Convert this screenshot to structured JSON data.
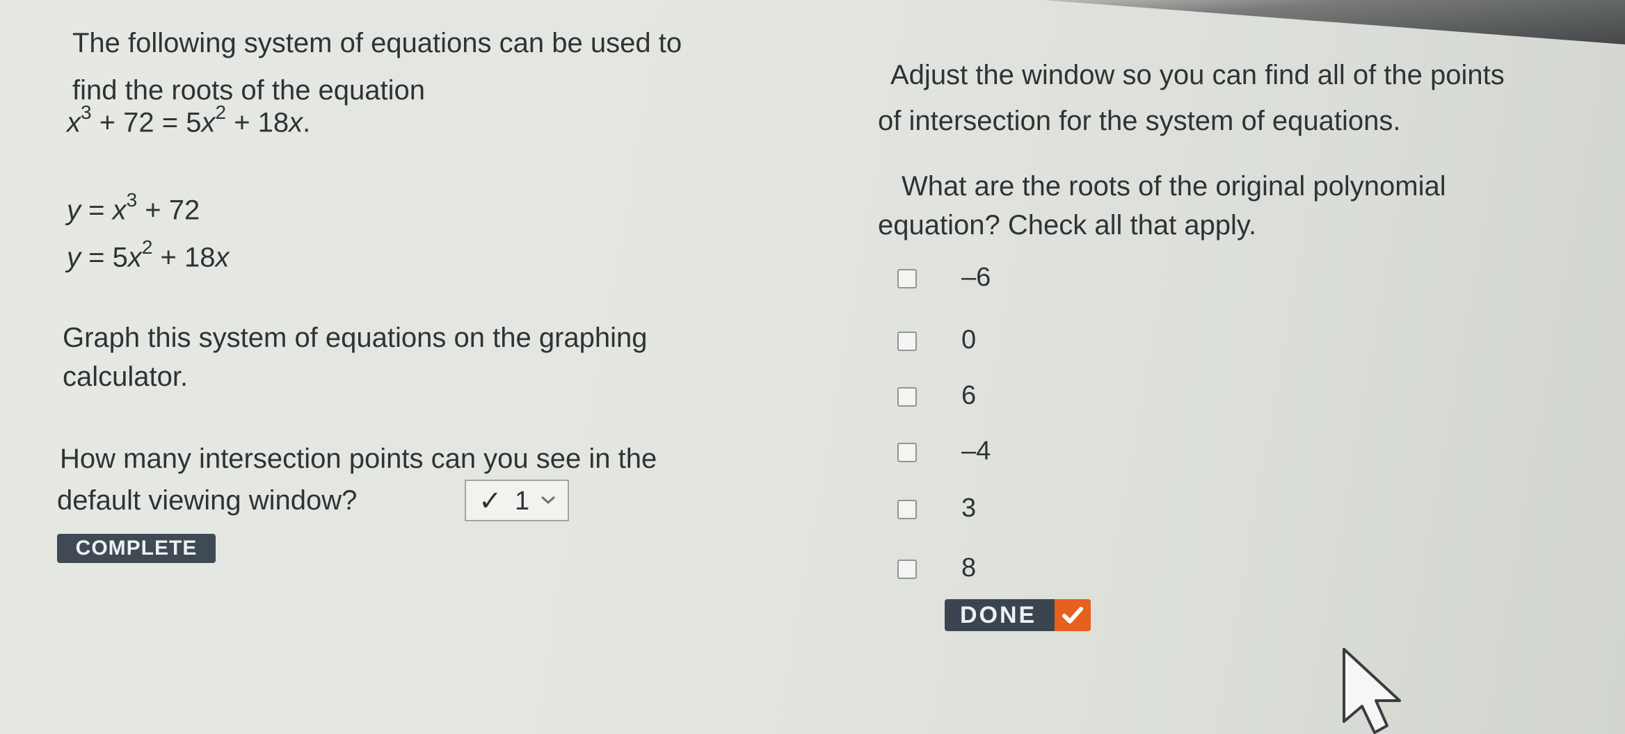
{
  "left_panel": {
    "intro_line1": "The following system of equations can be used to",
    "intro_line2": "find the roots of the equation",
    "equation": {
      "a": "x",
      "a_exp": "3",
      "b": " + 72 = 5",
      "c": "x",
      "c_exp": "2",
      "d": " + 18",
      "e": "x",
      "f": "."
    },
    "system_eq1": {
      "lhs": "y",
      "eq": " = ",
      "x": "x",
      "exp": "3",
      "rest": " + 72"
    },
    "system_eq2": {
      "lhs": "y",
      "eq": " = 5",
      "x": "x",
      "exp": "2",
      "rest": " + 18",
      "x2": "x"
    },
    "graph_line1": "Graph this system of equations on the graphing",
    "graph_line2": "calculator.",
    "question_line1": "How many intersection points can you see in the",
    "question_line2": "default viewing window?",
    "dropdown": {
      "checkmark": "✓",
      "selected": "1"
    },
    "status_badge": "COMPLETE"
  },
  "right_panel": {
    "instr_line1": "Adjust the window so you can find all of the points",
    "instr_line2": "of intersection for the system of equations.",
    "question_line1": "What are the roots of the original polynomial",
    "question_line2": "equation? Check all that apply.",
    "options": [
      {
        "label": "–6",
        "checked": false
      },
      {
        "label": "0",
        "checked": false
      },
      {
        "label": "6",
        "checked": false
      },
      {
        "label": "–4",
        "checked": false
      },
      {
        "label": "3",
        "checked": false
      },
      {
        "label": "8",
        "checked": false
      }
    ],
    "done_button": "DONE"
  },
  "colors": {
    "badge_bg": "#3f4a55",
    "done_bg": "#3b4550",
    "done_accent": "#e4611e"
  }
}
